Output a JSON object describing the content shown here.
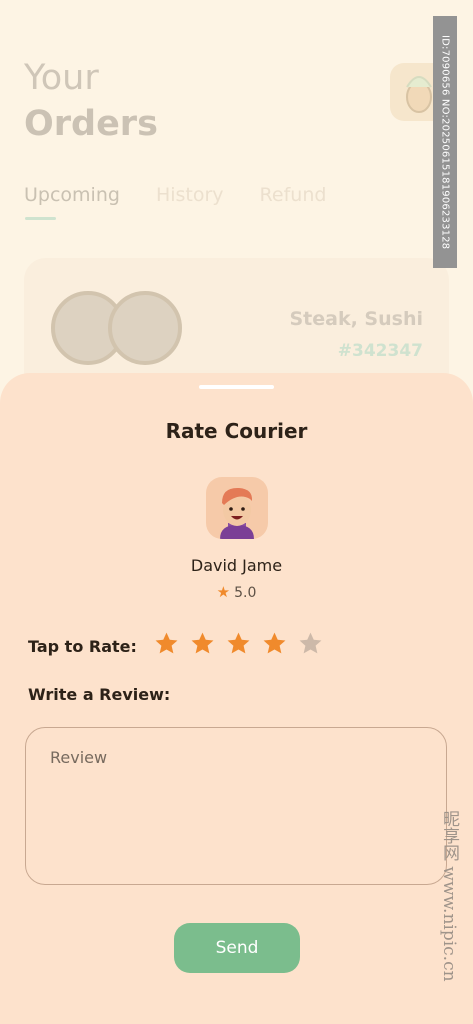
{
  "background": {
    "title_light": "Your",
    "title_bold": "Orders",
    "tabs": [
      {
        "label": "Upcoming",
        "active": true
      },
      {
        "label": "History",
        "active": false
      },
      {
        "label": "Refund",
        "active": false
      }
    ],
    "order": {
      "name": "Steak, Sushi",
      "id": "#342347"
    }
  },
  "sheet": {
    "title": "Rate Courier",
    "courier": {
      "name": "David Jame",
      "rating": "5.0"
    },
    "tap_label": "Tap to Rate:",
    "rating_selected": 4,
    "rating_max": 5,
    "review_label": "Write a Review:",
    "review_placeholder": "Review",
    "send_label": "Send"
  },
  "colors": {
    "accent_green": "#7bbd8d",
    "star_active": "#f08a2c",
    "star_inactive": "#cdb9a9",
    "sheet_bg": "#fde2cc"
  },
  "watermark": {
    "id_text": "ID:7090656 NO:20250615181906233128",
    "site": "昵享网 www.nipic.cn"
  }
}
